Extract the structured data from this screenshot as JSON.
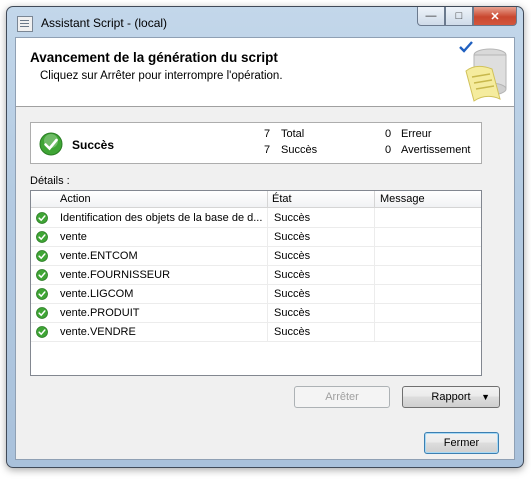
{
  "window": {
    "title": "Assistant Script - (local)",
    "controls": {
      "minimize": "—",
      "maximize": "□",
      "close": "✕"
    }
  },
  "header": {
    "title": "Avancement de la génération du script",
    "subtitle": "Cliquez sur Arrêter pour interrompre l'opération."
  },
  "summary": {
    "status": "Succès",
    "total_count": "7",
    "total_label": "Total",
    "success_count": "7",
    "success_label": "Succès",
    "error_count": "0",
    "error_label": "Erreur",
    "warning_count": "0",
    "warning_label": "Avertissement"
  },
  "details": {
    "label": "Détails :",
    "columns": [
      "Action",
      "État",
      "Message"
    ],
    "rows": [
      {
        "action": "Identification des objets de la base de d...",
        "state": "Succès",
        "message": ""
      },
      {
        "action": "vente",
        "state": "Succès",
        "message": ""
      },
      {
        "action": "vente.ENTCOM",
        "state": "Succès",
        "message": ""
      },
      {
        "action": "vente.FOURNISSEUR",
        "state": "Succès",
        "message": ""
      },
      {
        "action": "vente.LIGCOM",
        "state": "Succès",
        "message": ""
      },
      {
        "action": "vente.PRODUIT",
        "state": "Succès",
        "message": ""
      },
      {
        "action": "vente.VENDRE",
        "state": "Succès",
        "message": ""
      }
    ]
  },
  "buttons": {
    "stop": "Arrêter",
    "report": "Rapport",
    "close": "Fermer"
  },
  "colors": {
    "success_green": "#3fa535",
    "titlebar": "#b9cfe6",
    "close_red": "#c9472f"
  }
}
